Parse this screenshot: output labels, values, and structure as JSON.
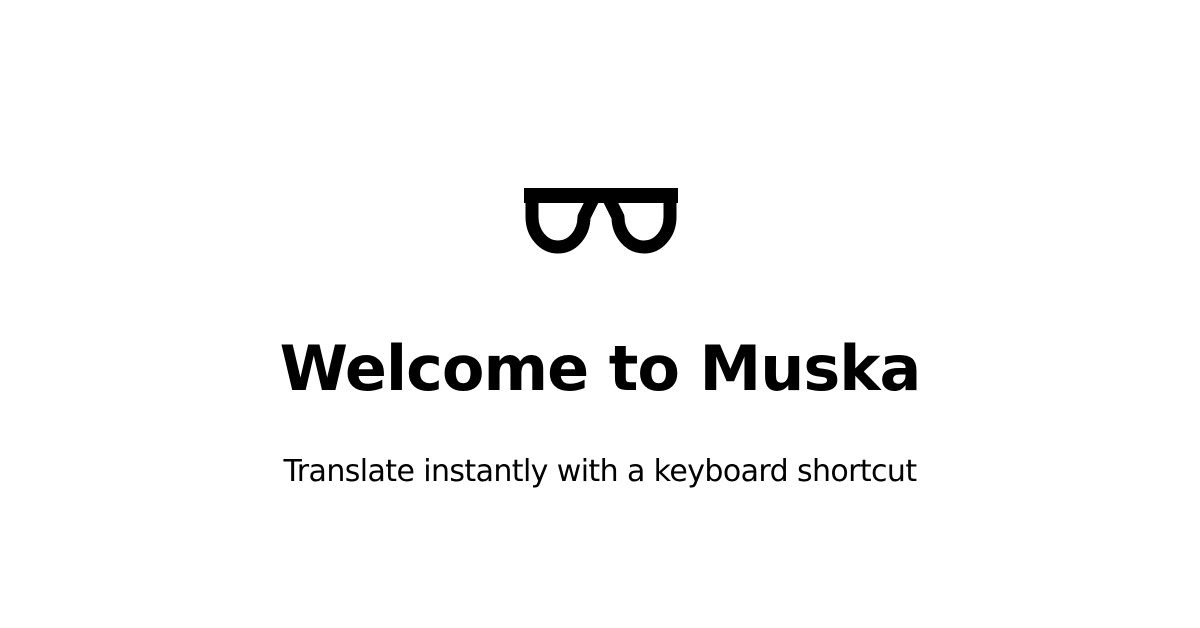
{
  "welcome": {
    "logo_icon": "glasses-icon",
    "title": "Welcome to Muska",
    "subtitle": "Translate instantly with a keyboard shortcut"
  },
  "colors": {
    "background": "#ffffff",
    "text": "#000000",
    "logo": "#000000"
  }
}
